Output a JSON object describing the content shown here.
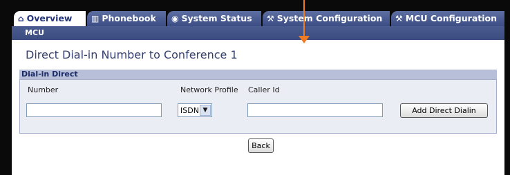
{
  "tabs": [
    {
      "label": "Overview",
      "icon": "home-icon",
      "glyph": "⌂",
      "active": true
    },
    {
      "label": "Phonebook",
      "icon": "phonebook-icon",
      "glyph": "▥",
      "active": false
    },
    {
      "label": "System Status",
      "icon": "status-icon",
      "glyph": "◉",
      "active": false
    },
    {
      "label": "System Configuration",
      "icon": "wrench-icon",
      "glyph": "⚒",
      "active": false
    },
    {
      "label": "MCU Configuration",
      "icon": "wrench-icon",
      "glyph": "⚒",
      "active": false
    }
  ],
  "subnav": {
    "label": "MCU"
  },
  "page": {
    "title": "Direct Dial-in Number to Conference 1"
  },
  "section": {
    "title": "Dial-in Direct",
    "number_label": "Number",
    "network_profile_label": "Network Profile",
    "caller_id_label": "Caller Id",
    "number_value": "",
    "network_profile_value": "ISDN",
    "caller_id_value": "",
    "add_button": "Add Direct Dialin"
  },
  "back_button": "Back",
  "colors": {
    "accent": "#3b4c80",
    "pointer_arrow": "#f07b22"
  }
}
